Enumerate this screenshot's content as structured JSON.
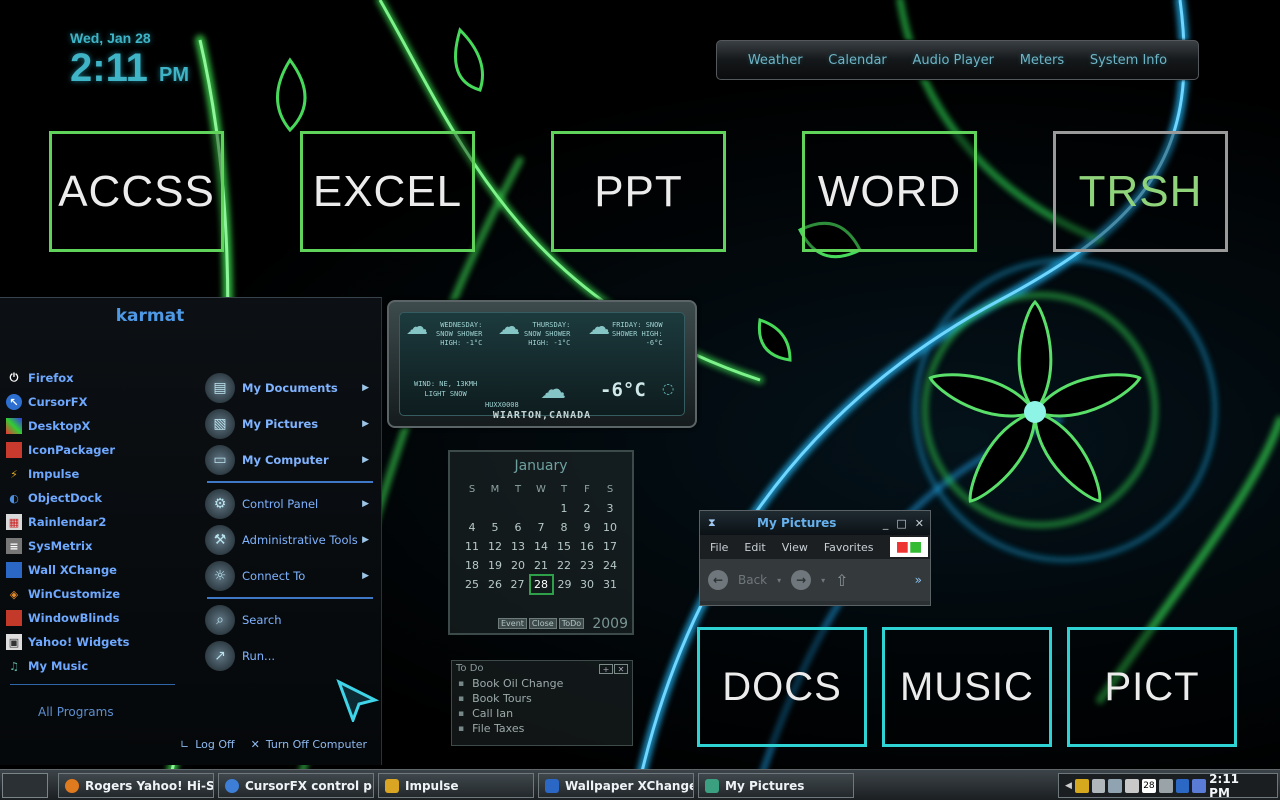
{
  "clock": {
    "date": "Wed, Jan 28",
    "time": "2:11",
    "ampm": "PM"
  },
  "widget_tabs": [
    "Weather",
    "Calendar",
    "Audio Player",
    "Meters",
    "System Info"
  ],
  "tiles_top": [
    "ACCSS",
    "EXCEL",
    "PPT",
    "WORD",
    "TRSH"
  ],
  "tiles_bottom": [
    "DOCS",
    "MUSIC",
    "PICT"
  ],
  "start_menu": {
    "user": "karmat",
    "programs": [
      {
        "label": "Firefox",
        "icon": "power-icon"
      },
      {
        "label": "CursorFX",
        "icon": "cursorfx-icon"
      },
      {
        "label": "DesktopX",
        "icon": "desktopx-icon"
      },
      {
        "label": "IconPackager",
        "icon": "iconpackager-icon"
      },
      {
        "label": "Impulse",
        "icon": "impulse-icon"
      },
      {
        "label": "ObjectDock",
        "icon": "objectdock-icon"
      },
      {
        "label": "Rainlendar2",
        "icon": "rainlendar-icon"
      },
      {
        "label": "SysMetrix",
        "icon": "sysmetrix-icon"
      },
      {
        "label": "Wall XChange",
        "icon": "wallxchange-icon"
      },
      {
        "label": "WinCustomize",
        "icon": "wincustomize-icon"
      },
      {
        "label": "WindowBlinds",
        "icon": "windowblinds-icon"
      },
      {
        "label": "Yahoo! Widgets",
        "icon": "yahoo-widgets-icon"
      },
      {
        "label": "My Music",
        "icon": "music-icon"
      }
    ],
    "all_programs": "All Programs",
    "places": [
      {
        "label": "My Documents"
      },
      {
        "label": "My Pictures"
      },
      {
        "label": "My Computer"
      }
    ],
    "system": [
      {
        "label": "Control Panel"
      },
      {
        "label": "Administrative Tools"
      },
      {
        "label": "Connect To"
      }
    ],
    "actions": [
      {
        "label": "Search"
      },
      {
        "label": "Run..."
      }
    ],
    "log_off": "Log Off",
    "turn_off": "Turn Off Computer"
  },
  "weather": {
    "days": [
      {
        "label": "WEDNESDAY:",
        "cond": "SNOW SHOWER",
        "high": "HIGH: -1°C"
      },
      {
        "label": "THURSDAY:",
        "cond": "SNOW SHOWER",
        "high": "HIGH: -1°C"
      },
      {
        "label": "FRIDAY: SNOW",
        "cond": "SHOWER HIGH:",
        "high": "-6°C"
      }
    ],
    "wind": "WIND: NE, 13KMH",
    "condition": "LIGHT SNOW",
    "code": "HUXX0008",
    "temp": "-6°C",
    "city": "WIARTON,CANADA"
  },
  "calendar": {
    "month": "January",
    "year": "2009",
    "weekdays": [
      "S",
      "M",
      "T",
      "W",
      "T",
      "F",
      "S"
    ],
    "weeks": [
      [
        "",
        "",
        "",
        "",
        "1",
        "2",
        "3"
      ],
      [
        "4",
        "5",
        "6",
        "7",
        "8",
        "9",
        "10"
      ],
      [
        "11",
        "12",
        "13",
        "14",
        "15",
        "16",
        "17"
      ],
      [
        "18",
        "19",
        "20",
        "21",
        "22",
        "23",
        "24"
      ],
      [
        "25",
        "26",
        "27",
        "28",
        "29",
        "30",
        "31"
      ]
    ],
    "today": "28",
    "buttons": [
      "Event",
      "Close",
      "ToDo"
    ]
  },
  "todo": {
    "title": "To Do",
    "items": [
      "Book Oil Change",
      "Book Tours",
      "Call Ian",
      "File Taxes"
    ]
  },
  "window": {
    "title": "My Pictures",
    "menu": [
      "File",
      "Edit",
      "View",
      "Favorites"
    ],
    "back": "Back"
  },
  "taskbar": {
    "tasks": [
      {
        "label": "Rogers Yahoo! Hi-S...",
        "color": "#e07a1f"
      },
      {
        "label": "CursorFX control p...",
        "color": "#3d7fd6"
      },
      {
        "label": "Impulse",
        "color": "#d9a522"
      },
      {
        "label": "Wallpaper XChange",
        "color": "#2b67c4"
      },
      {
        "label": "My Pictures",
        "color": "#3aa080"
      }
    ],
    "time": "2:11 PM",
    "tray_day": "28"
  },
  "colors": {
    "tile_green": "#5fd35a",
    "tile_cyan": "#2fd3d3",
    "accent_blue": "#6ea8ff"
  }
}
